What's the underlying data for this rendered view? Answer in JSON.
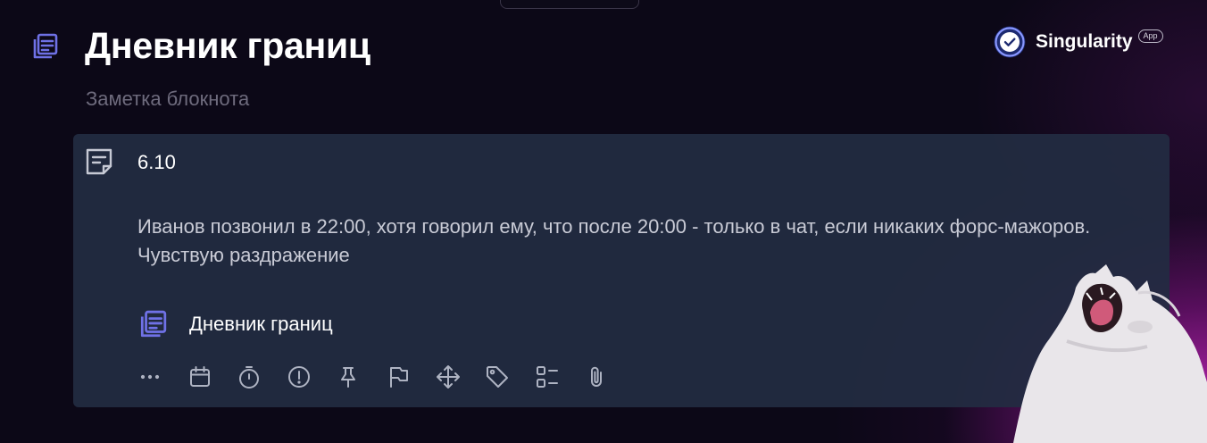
{
  "header": {
    "title": "Дневник границ",
    "subtitle": "Заметка блокнота",
    "icon": "notebook-icon"
  },
  "brand": {
    "name": "Singularity",
    "badge": "App",
    "logo_icon": "checkmark-circle-logo"
  },
  "note": {
    "icon": "note-icon",
    "date": "6.10",
    "text": "Иванов позвонил в 22:00, хотя говорил ему, что после 20:00 - только в чат, если никаких форс-мажоров. Чувствую раздражение",
    "notebook": {
      "icon": "notebook-icon",
      "label": "Дневник границ"
    }
  },
  "toolbar": {
    "icons": [
      "more-icon",
      "calendar-icon",
      "timer-icon",
      "priority-icon",
      "pin-icon",
      "flag-icon",
      "move-icon",
      "tag-icon",
      "checklist-icon",
      "attachment-icon"
    ]
  },
  "colors": {
    "background": "#0c0817",
    "card": "#222c42",
    "accent_icon": "#6f71e6",
    "glow": "#c828be",
    "muted_text": "#6e6b7d"
  },
  "decoration": {
    "image": "screaming white cat"
  }
}
